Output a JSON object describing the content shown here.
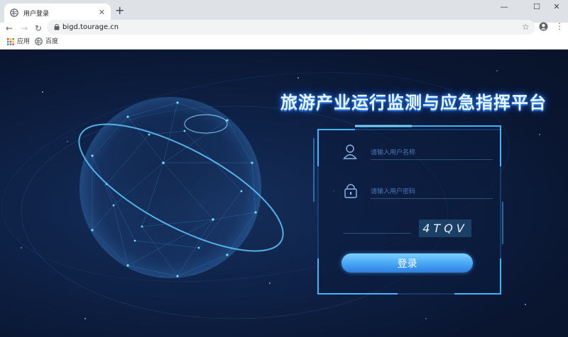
{
  "browser": {
    "tab_title": "用户登录",
    "new_tab_label": "+",
    "close_tab_label": "✕",
    "window_controls": {
      "minimize": "—",
      "maximize": "☐",
      "close": "✕"
    },
    "url": "bigd.tourage.cn",
    "bookmarks": [
      {
        "label": "应用",
        "icon": "apps-grid-icon"
      },
      {
        "label": "百度",
        "icon": "globe-icon"
      }
    ]
  },
  "page": {
    "platform_title": "旅游产业运行监测与应急指挥平台",
    "login": {
      "username_placeholder": "请输入用户名称",
      "password_placeholder": "请输入用户密码",
      "captcha_code": "4TQV",
      "captcha_input_value": "",
      "submit_label": "登录"
    }
  },
  "colors": {
    "background": "#0b1a33",
    "accent": "#4aa8f6",
    "frame": "#3fb4ff",
    "title_glow": "#2e8bff"
  }
}
